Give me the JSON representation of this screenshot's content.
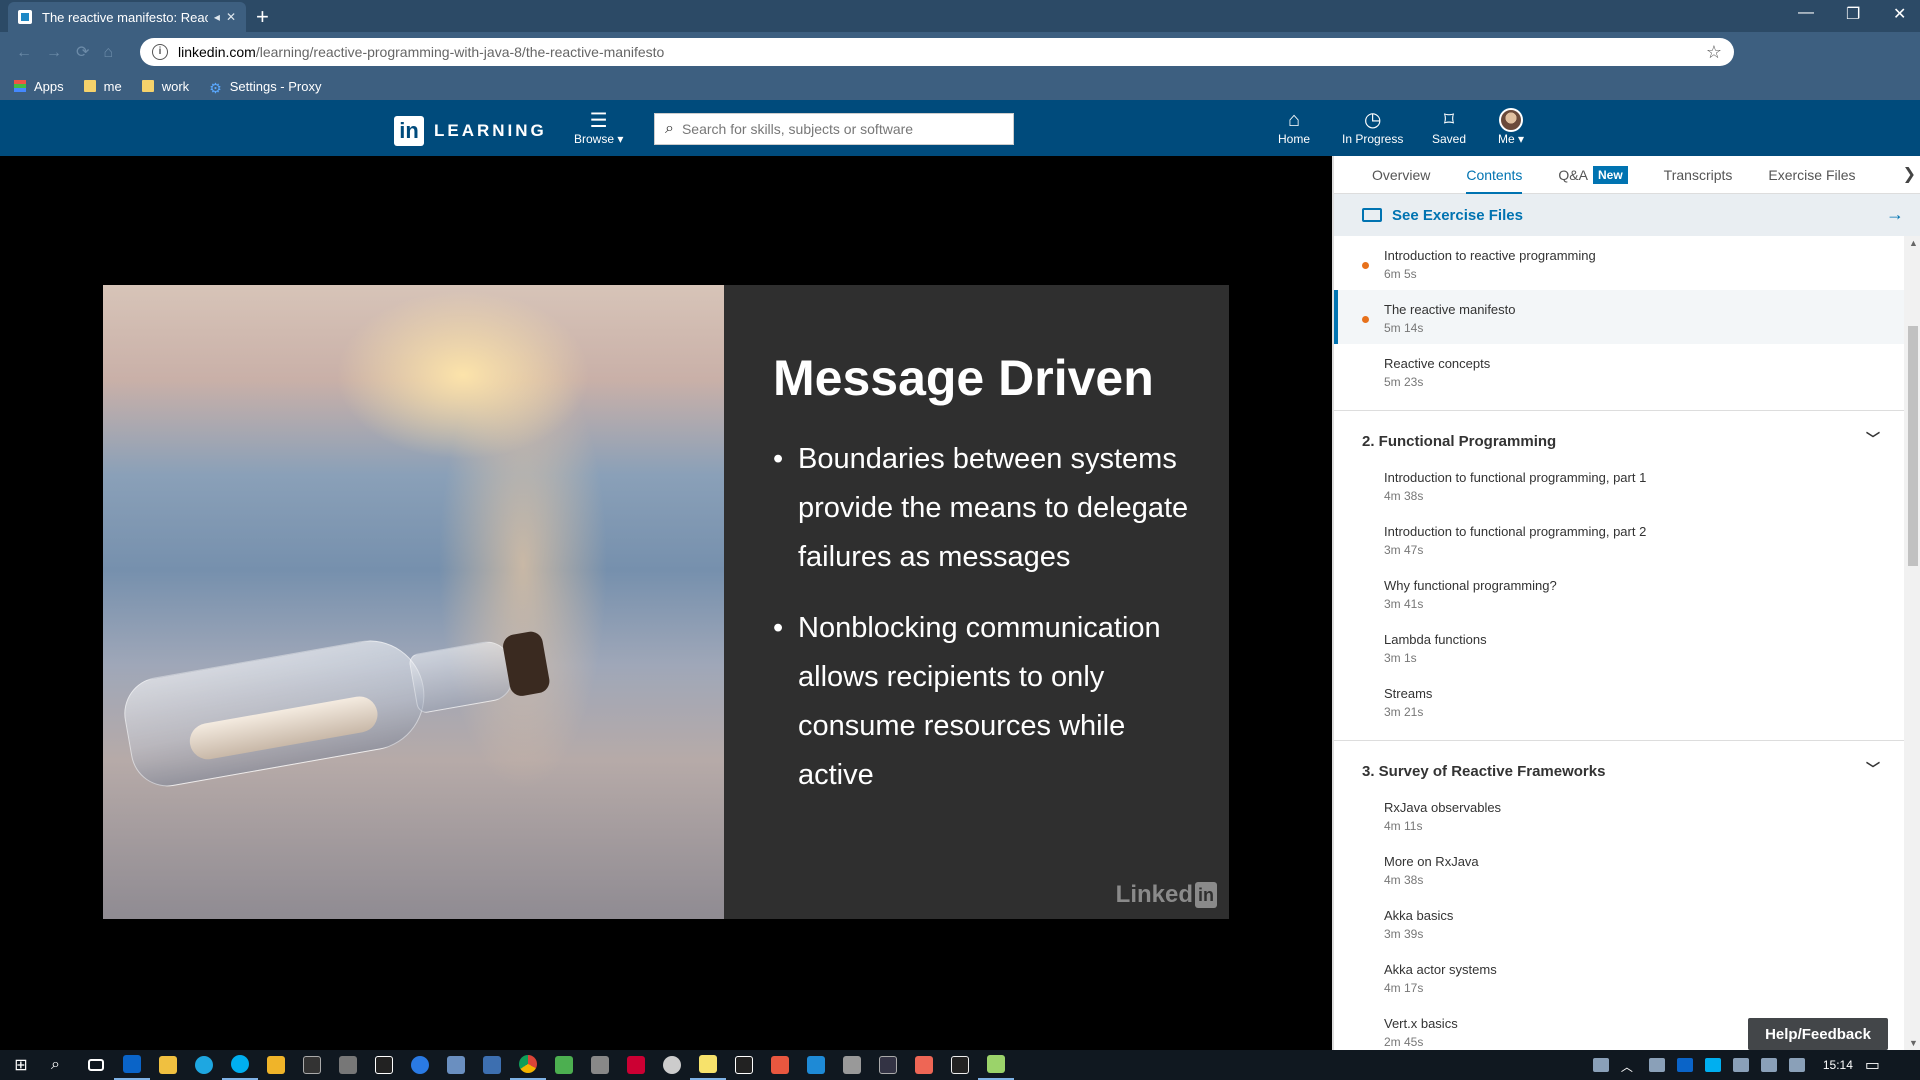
{
  "browser": {
    "tab_title": "The reactive manifesto: Reac",
    "url_host": "linkedin.com",
    "url_path": "/learning/reactive-programming-with-java-8/the-reactive-manifesto",
    "bookmarks": [
      "Apps",
      "me",
      "work",
      "Settings - Proxy"
    ]
  },
  "header": {
    "logo_in": "in",
    "logo_text": "LEARNING",
    "browse_label": "Browse ▾",
    "search_placeholder": "Search for skills, subjects or software",
    "nav": {
      "home": "Home",
      "in_progress": "In Progress",
      "saved": "Saved",
      "me": "Me ▾"
    }
  },
  "slide": {
    "heading": "Message Driven",
    "bullets": [
      "Boundaries between systems provide the means to delegate failures as messages",
      "Nonblocking communication allows recipients to only consume resources while active"
    ],
    "watermark_text": "Linked",
    "watermark_in": "in"
  },
  "panel": {
    "tabs": [
      "Overview",
      "Contents",
      "Q&A",
      "Transcripts",
      "Exercise Files"
    ],
    "qa_badge": "New",
    "exercise_files_label": "See Exercise Files",
    "section1_items": [
      {
        "title": "Introduction to reactive programming",
        "duration": "6m 5s"
      },
      {
        "title": "The reactive manifesto",
        "duration": "5m 14s"
      },
      {
        "title": "Reactive concepts",
        "duration": "5m 23s"
      }
    ],
    "section2_title": "2. Functional Programming",
    "section2_items": [
      {
        "title": "Introduction to functional programming, part 1",
        "duration": "4m 38s"
      },
      {
        "title": "Introduction to functional programming, part 2",
        "duration": "3m 47s"
      },
      {
        "title": "Why functional programming?",
        "duration": "3m 41s"
      },
      {
        "title": "Lambda functions",
        "duration": "3m 1s"
      },
      {
        "title": "Streams",
        "duration": "3m 21s"
      }
    ],
    "section3_title": "3. Survey of Reactive Frameworks",
    "section3_items": [
      {
        "title": "RxJava observables",
        "duration": "4m 11s"
      },
      {
        "title": "More on RxJava",
        "duration": "4m 38s"
      },
      {
        "title": "Akka basics",
        "duration": "3m 39s"
      },
      {
        "title": "Akka actor systems",
        "duration": "4m 17s"
      },
      {
        "title": "Vert.x basics",
        "duration": "2m 45s"
      }
    ],
    "help_label": "Help/Feedback"
  },
  "taskbar": {
    "clock": "15:14"
  },
  "colors": {
    "brand_blue": "#004b7c",
    "accent_blue": "#0073b1",
    "progress_dot": "#e7711b"
  }
}
